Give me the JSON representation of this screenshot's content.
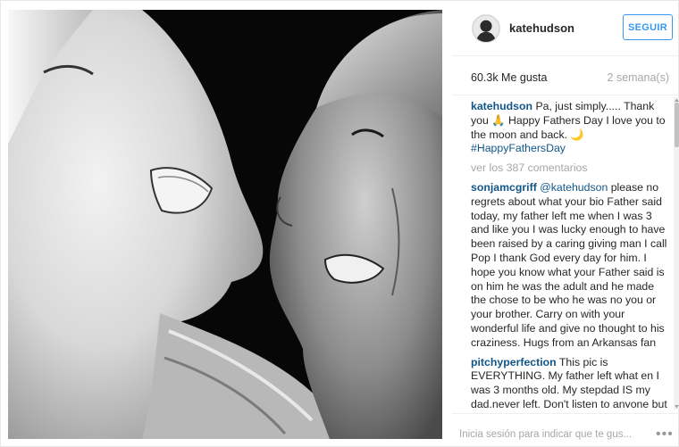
{
  "post": {
    "username": "katehudson",
    "follow_label": "SEGUIR",
    "likes": "60.3k Me gusta",
    "time": "2 semana(s)",
    "caption": {
      "user": "katehudson",
      "text": "Pa, just simply..... Thank you 🙏 Happy Fathers Day I love you to the moon and back. 🌙",
      "hashtag": "#HappyFathersDay"
    },
    "view_comments": "ver los 387 comentarios",
    "comments": [
      {
        "user": "sonjamcgriff",
        "mention": "@katehudson",
        "text": "please no regrets about what your bio Father said today, my father left me when I was 3 and like you I was lucky enough to have been raised by a caring giving man I call Pop I thank God every day for him. I hope you know what your Father said is on him he was the adult and he made the chose to be who he was no you or your brother. Carry on with your wonderful life and give no thought to his craziness. Hugs from an Arkansas fan"
      },
      {
        "user": "pitchyperfection",
        "mention": "",
        "text": "This pic is EVERYTHING. My father left what en I was 3 months old. My stepdad IS my dad.never left. Don't listen to anyone but YOU.your heart belongs to Kurt. The one and only man that you should call daddy. The one that was there. ♥"
      }
    ],
    "footer_login": "Inicia sesión para indicar que te gus...",
    "more_options": "•••"
  },
  "colors": {
    "link_blue": "#125688",
    "button_blue": "#3897f0",
    "muted_gray": "#a5a7aa"
  }
}
